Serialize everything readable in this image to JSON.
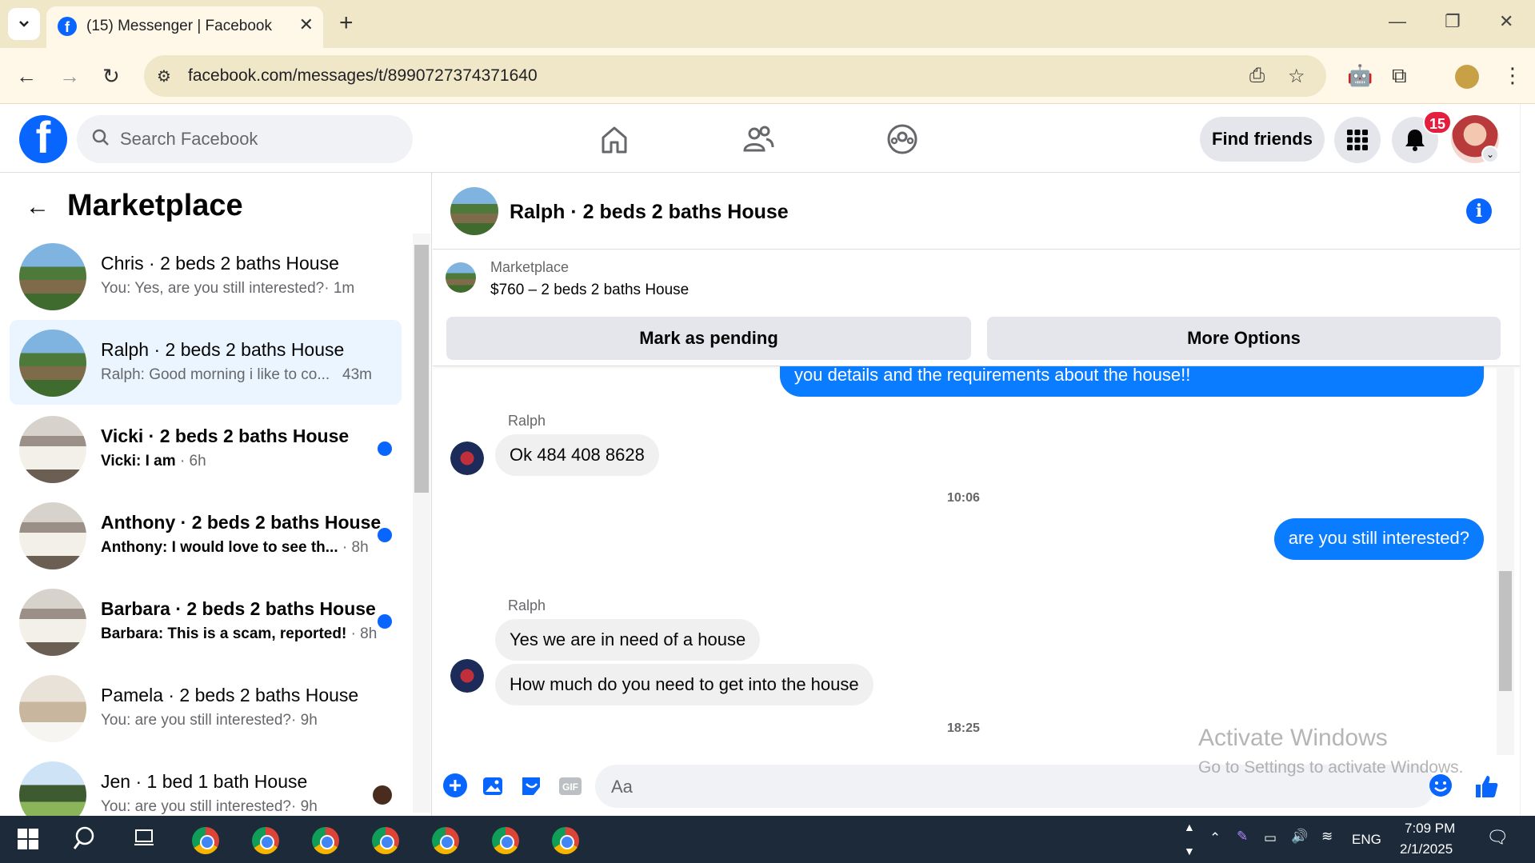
{
  "browser": {
    "tab_title": "(15) Messenger | Facebook",
    "url": "facebook.com/messages/t/8990727374371640"
  },
  "fb": {
    "search_placeholder": "Search Facebook",
    "find_friends": "Find friends",
    "notification_count": "15"
  },
  "left": {
    "title": "Marketplace",
    "conversations": [
      {
        "name": "Chris · 2 beds 2 baths House",
        "preview": "You: Yes, are you still interested?",
        "time": "· 1m",
        "unread": false
      },
      {
        "name": "Ralph · 2 beds 2 baths House",
        "preview": "Ralph: Good morning i like to co...",
        "time": "43m",
        "unread": false
      },
      {
        "name": "Vicki · 2 beds 2 baths House",
        "preview": "Vicki: I am",
        "time": "· 6h",
        "unread": true
      },
      {
        "name": "Anthony · 2 beds 2 baths House",
        "preview": "Anthony: I would love to see th...",
        "time": "· 8h",
        "unread": true
      },
      {
        "name": "Barbara · 2 beds 2 baths House",
        "preview": "Barbara: This is a scam, reported!",
        "time": "· 8h",
        "unread": true
      },
      {
        "name": "Pamela · 2 beds 2 baths House",
        "preview": "You: are you still interested?",
        "time": "· 9h",
        "unread": false
      },
      {
        "name": "Jen · 1 bed 1 bath House",
        "preview": "You: are you still interested?",
        "time": "· 9h",
        "unread": false
      }
    ]
  },
  "chat": {
    "title": "Ralph · 2 beds 2 baths House",
    "marketplace_label": "Marketplace",
    "listing": "$760 – 2 beds 2 baths House",
    "mark_pending": "Mark as pending",
    "more_options": "More Options",
    "messages": {
      "out_1": "you details and the requirements about the house!!",
      "sender_1": "Ralph",
      "in_1": "Ok 484 408 8628",
      "time_1": "10:06",
      "out_2": "are you still interested?",
      "sender_2": "Ralph",
      "in_2": "Yes we are in need of a house",
      "in_3": "How much do you need to get into the house",
      "time_2": "18:25"
    },
    "composer_placeholder": "Aa"
  },
  "watermark": {
    "line1": "Activate Windows",
    "line2": "Go to Settings to activate Windows."
  },
  "taskbar": {
    "lang": "ENG",
    "time": "7:09 PM",
    "date": "2/1/2025"
  }
}
